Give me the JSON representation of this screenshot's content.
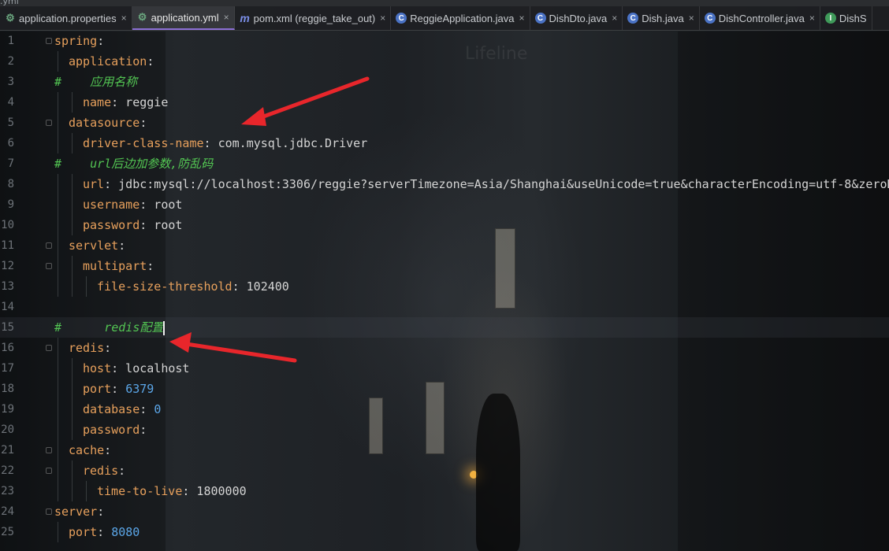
{
  "window": {
    "partial_title": ".yml"
  },
  "tabs": [
    {
      "label": "application.properties",
      "icon": "gear-leaf-icon",
      "icon_kind": "gear",
      "active": false,
      "closable": true
    },
    {
      "label": "application.yml",
      "icon": "gear-leaf-icon",
      "icon_kind": "gear",
      "active": true,
      "closable": true
    },
    {
      "label": "pom.xml (reggie_take_out)",
      "icon": "maven-icon",
      "icon_kind": "m",
      "active": false,
      "closable": true
    },
    {
      "label": "ReggieApplication.java",
      "icon": "spring-class-icon",
      "icon_kind": "c",
      "active": false,
      "closable": true
    },
    {
      "label": "DishDto.java",
      "icon": "class-icon",
      "icon_kind": "c",
      "active": false,
      "closable": true
    },
    {
      "label": "Dish.java",
      "icon": "class-icon",
      "icon_kind": "c",
      "active": false,
      "closable": true
    },
    {
      "label": "DishController.java",
      "icon": "class-icon",
      "icon_kind": "c",
      "active": false,
      "closable": true
    },
    {
      "label": "DishS",
      "icon": "interface-icon",
      "icon_kind": "i",
      "active": false,
      "closable": false
    }
  ],
  "close_glyph": "×",
  "background_text": "Lifeline",
  "current_line": 15,
  "lines": [
    {
      "n": "1",
      "indent": 0,
      "parts": [
        {
          "t": "spring",
          "c": "k"
        },
        {
          "t": ":",
          "c": "v"
        }
      ]
    },
    {
      "n": "2",
      "indent": 1,
      "parts": [
        {
          "t": "application",
          "c": "k"
        },
        {
          "t": ":",
          "c": "v"
        }
      ]
    },
    {
      "n": "3",
      "indent": 0,
      "parts": [
        {
          "t": "#    ",
          "c": "hash"
        },
        {
          "t": "应用名称",
          "c": "cm"
        }
      ]
    },
    {
      "n": "4",
      "indent": 2,
      "parts": [
        {
          "t": "name",
          "c": "k"
        },
        {
          "t": ": reggie",
          "c": "v"
        }
      ]
    },
    {
      "n": "5",
      "indent": 1,
      "parts": [
        {
          "t": "datasource",
          "c": "k"
        },
        {
          "t": ":",
          "c": "v"
        }
      ]
    },
    {
      "n": "6",
      "indent": 2,
      "parts": [
        {
          "t": "driver-class-name",
          "c": "k"
        },
        {
          "t": ": com.mysql.jdbc.Driver",
          "c": "v"
        }
      ]
    },
    {
      "n": "7",
      "indent": 0,
      "parts": [
        {
          "t": "#    ",
          "c": "hash"
        },
        {
          "t": "url后边加参数,防乱码",
          "c": "cm"
        }
      ]
    },
    {
      "n": "8",
      "indent": 2,
      "parts": [
        {
          "t": "url",
          "c": "k"
        },
        {
          "t": ": jdbc:mysql://localhost:3306/reggie?serverTimezone=Asia/Shanghai&useUnicode=true&characterEncoding=utf-8&zeroD",
          "c": "v"
        }
      ]
    },
    {
      "n": "9",
      "indent": 2,
      "parts": [
        {
          "t": "username",
          "c": "k"
        },
        {
          "t": ": root",
          "c": "v"
        }
      ]
    },
    {
      "n": "10",
      "indent": 2,
      "parts": [
        {
          "t": "password",
          "c": "k"
        },
        {
          "t": ": root",
          "c": "v"
        }
      ]
    },
    {
      "n": "11",
      "indent": 1,
      "parts": [
        {
          "t": "servlet",
          "c": "k"
        },
        {
          "t": ":",
          "c": "v"
        }
      ]
    },
    {
      "n": "12",
      "indent": 2,
      "parts": [
        {
          "t": "multipart",
          "c": "k"
        },
        {
          "t": ":",
          "c": "v"
        }
      ]
    },
    {
      "n": "13",
      "indent": 3,
      "parts": [
        {
          "t": "file-size-threshold",
          "c": "k"
        },
        {
          "t": ": 102400",
          "c": "v"
        }
      ]
    },
    {
      "n": "14",
      "indent": 0,
      "parts": []
    },
    {
      "n": "15",
      "indent": 0,
      "parts": [
        {
          "t": "#      ",
          "c": "hash"
        },
        {
          "t": "redis配置",
          "c": "cm"
        }
      ],
      "caret": true
    },
    {
      "n": "16",
      "indent": 1,
      "parts": [
        {
          "t": "redis",
          "c": "k"
        },
        {
          "t": ":",
          "c": "v"
        }
      ]
    },
    {
      "n": "17",
      "indent": 2,
      "parts": [
        {
          "t": "host",
          "c": "k"
        },
        {
          "t": ": localhost",
          "c": "v"
        }
      ]
    },
    {
      "n": "18",
      "indent": 2,
      "parts": [
        {
          "t": "port",
          "c": "k"
        },
        {
          "t": ": ",
          "c": "v"
        },
        {
          "t": "6379",
          "c": "n"
        }
      ]
    },
    {
      "n": "19",
      "indent": 2,
      "parts": [
        {
          "t": "database",
          "c": "k"
        },
        {
          "t": ": ",
          "c": "v"
        },
        {
          "t": "0",
          "c": "n"
        }
      ]
    },
    {
      "n": "20",
      "indent": 2,
      "parts": [
        {
          "t": "password",
          "c": "k"
        },
        {
          "t": ":",
          "c": "v"
        }
      ]
    },
    {
      "n": "21",
      "indent": 1,
      "parts": [
        {
          "t": "cache",
          "c": "k"
        },
        {
          "t": ":",
          "c": "v"
        }
      ]
    },
    {
      "n": "22",
      "indent": 2,
      "parts": [
        {
          "t": "redis",
          "c": "k"
        },
        {
          "t": ":",
          "c": "v"
        }
      ]
    },
    {
      "n": "23",
      "indent": 3,
      "parts": [
        {
          "t": "time-to-live",
          "c": "k"
        },
        {
          "t": ": 1800000",
          "c": "v"
        }
      ]
    },
    {
      "n": "24",
      "indent": 0,
      "parts": [
        {
          "t": "server",
          "c": "k"
        },
        {
          "t": ":",
          "c": "v"
        }
      ]
    },
    {
      "n": "25",
      "indent": 1,
      "parts": [
        {
          "t": "port",
          "c": "k"
        },
        {
          "t": ": ",
          "c": "v"
        },
        {
          "t": "8080",
          "c": "n"
        }
      ]
    }
  ],
  "annotation_color": "#e8262b"
}
